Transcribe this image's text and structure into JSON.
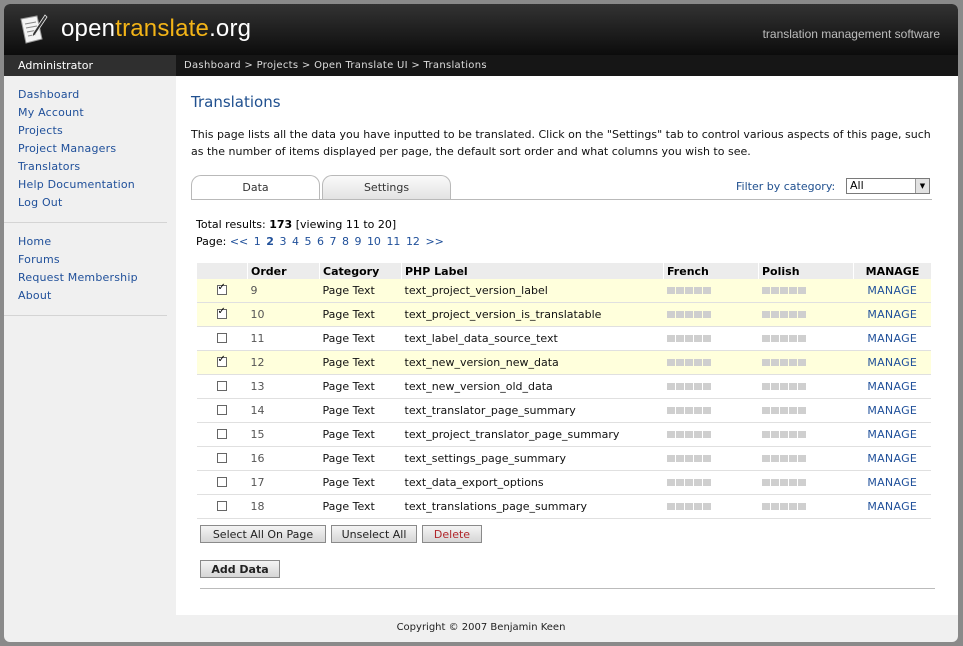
{
  "header": {
    "logo_prefix": "open",
    "logo_accent": "translate",
    "logo_suffix": ".org",
    "tagline": "translation management software"
  },
  "userbar": {
    "role": "Administrator"
  },
  "breadcrumb": [
    "Dashboard",
    "Projects",
    "Open Translate UI",
    "Translations"
  ],
  "sidebar": {
    "group1": [
      "Dashboard",
      "My Account",
      "Projects",
      "Project Managers",
      "Translators",
      "Help Documentation",
      "Log Out"
    ],
    "group2": [
      "Home",
      "Forums",
      "Request Membership",
      "About"
    ]
  },
  "main": {
    "title": "Translations",
    "intro": "This page lists all the data you have inputted to be translated. Click on the \"Settings\" tab to control various aspects of this page, such as the number of items displayed per page, the default sort order and what columns you wish to see.",
    "tabs": {
      "data": "Data",
      "settings": "Settings"
    },
    "filter": {
      "label": "Filter by category:",
      "value": "All"
    },
    "results": {
      "label": "Total results:",
      "count": "173",
      "viewing": "[viewing 11 to 20]",
      "page_label": "Page:"
    },
    "pager": {
      "prev": "<<",
      "pages": [
        "1",
        "2",
        "3",
        "4",
        "5",
        "6",
        "7",
        "8",
        "9",
        "10",
        "11",
        "12"
      ],
      "current": "2",
      "next": ">>"
    },
    "columns": [
      "Order",
      "Category",
      "PHP Label",
      "French",
      "Polish",
      "MANAGE"
    ],
    "rows": [
      {
        "checked": true,
        "order": "9",
        "category": "Page Text",
        "label": "text_project_version_label",
        "manage": "MANAGE"
      },
      {
        "checked": true,
        "order": "10",
        "category": "Page Text",
        "label": "text_project_version_is_translatable",
        "manage": "MANAGE"
      },
      {
        "checked": false,
        "order": "11",
        "category": "Page Text",
        "label": "text_label_data_source_text",
        "manage": "MANAGE"
      },
      {
        "checked": true,
        "order": "12",
        "category": "Page Text",
        "label": "text_new_version_new_data",
        "manage": "MANAGE"
      },
      {
        "checked": false,
        "order": "13",
        "category": "Page Text",
        "label": "text_new_version_old_data",
        "manage": "MANAGE"
      },
      {
        "checked": false,
        "order": "14",
        "category": "Page Text",
        "label": "text_translator_page_summary",
        "manage": "MANAGE"
      },
      {
        "checked": false,
        "order": "15",
        "category": "Page Text",
        "label": "text_project_translator_page_summary",
        "manage": "MANAGE"
      },
      {
        "checked": false,
        "order": "16",
        "category": "Page Text",
        "label": "text_settings_page_summary",
        "manage": "MANAGE"
      },
      {
        "checked": false,
        "order": "17",
        "category": "Page Text",
        "label": "text_data_export_options",
        "manage": "MANAGE"
      },
      {
        "checked": false,
        "order": "18",
        "category": "Page Text",
        "label": "text_translations_page_summary",
        "manage": "MANAGE"
      }
    ],
    "buttons": {
      "select_all": "Select All On Page",
      "unselect_all": "Unselect All",
      "delete": "Delete",
      "add": "Add Data"
    }
  },
  "footer": "Copyright © 2007 Benjamin Keen",
  "colors": {
    "link": "#20509a",
    "accent": "#f3b417",
    "selected_row": "#ffffdc",
    "delete": "#b0262b"
  }
}
